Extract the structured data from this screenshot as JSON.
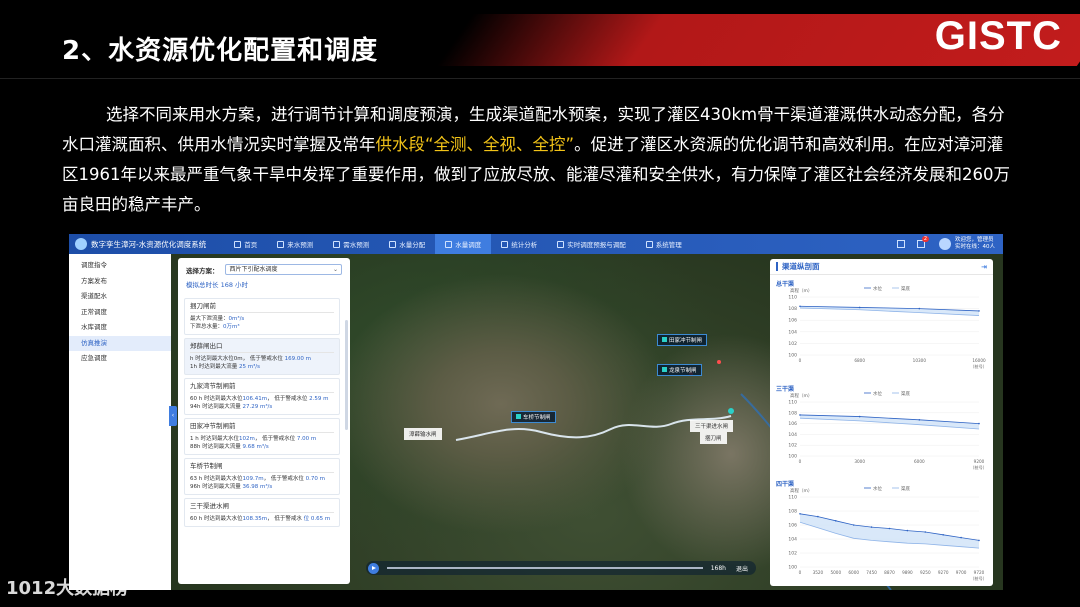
{
  "slide": {
    "title": "2、水资源优化配置和调度",
    "logo": "GISTC",
    "paragraph_pre": "选择不同来用水方案，进行调节计算和调度预演，生成渠道配水预案，实现了灌区430km骨干渠道灌溉供水动态分配，各分水口灌溉面积、供用水情况实时掌握及常年",
    "paragraph_hl": "供水段“全测、全视、全控”",
    "paragraph_post": "。促进了灌区水资源的优化调节和高效利用。在应对漳河灌区1961年以来最严重气象干旱中发挥了重要作用，做到了应放尽放、能灌尽灌和安全供水，有力保障了灌区社会经济发展和260万亩良田的稳产丰产。",
    "watermark": "1012大数据榜"
  },
  "colors": {
    "accent": "#2e63c4",
    "banner": "#c21c1c",
    "highlight": "#f2c318"
  },
  "app": {
    "title": "数字孪生漳河-水资源优化调度系统",
    "nav": [
      {
        "label": "首页",
        "icon": "home-icon"
      },
      {
        "label": "来水预测",
        "icon": "inflow-icon"
      },
      {
        "label": "需水预测",
        "icon": "demand-icon"
      },
      {
        "label": "水量分配",
        "icon": "allocation-icon"
      },
      {
        "label": "水量调度",
        "icon": "dispatch-icon",
        "active": true
      },
      {
        "label": "统计分析",
        "icon": "stats-icon"
      },
      {
        "label": "实时调度预报与调配",
        "icon": "realtime-icon"
      },
      {
        "label": "系统管理",
        "icon": "settings-icon"
      }
    ],
    "user": {
      "badge": "2",
      "name": "欢迎您，管理员",
      "online": "实时在线：40人"
    },
    "sidebar": [
      "调度指令",
      "方案发布",
      "渠道配水",
      "正常调度",
      "水库调度",
      "仿真推演",
      "应急调度"
    ],
    "sidebar_active": 5,
    "panel": {
      "select_label": "选择方案：",
      "select_value": "西片下引配水调度",
      "sim_time": "模拟总时长  168 小时",
      "cards": [
        {
          "title": "捆刀闸前",
          "lines": [
            [
              "最大下泄流量：",
              "0m³/s"
            ],
            [
              "下泄总水量：",
              "0万m³"
            ]
          ]
        },
        {
          "title": "郑薛闸出口",
          "active": true,
          "lines": [
            [
              "h  时达到最大水位0m，   低于警戒水位 ",
              "169.00 m"
            ],
            [
              "1h  时达到最大流量 ",
              "25 m³/s"
            ]
          ]
        },
        {
          "title": "九家湾节制闸前",
          "lines": [
            [
              "60 h   时达到最大水位",
              "106.41m",
              "，  低于警戒水位 ",
              "2.59 m"
            ],
            [
              "94h    时达到最大流量 ",
              "27.29 m³/s"
            ]
          ]
        },
        {
          "title": "田家冲节制闸前",
          "lines": [
            [
              "1 h    时达到最大水位",
              "102m",
              "，  低于警戒水位 ",
              "7.00 m"
            ],
            [
              "88h    时达到最大流量 ",
              "9.68 m³/s"
            ]
          ]
        },
        {
          "title": "车桥节制闸",
          "lines": [
            [
              "63 h   时达到最大水位",
              "109.7m",
              "，  低于警戒水位 ",
              "0.70 m"
            ],
            [
              "96h    时达到最大流量 ",
              "36.98 m³/s"
            ]
          ]
        },
        {
          "title": "三干渠进水闸",
          "lines": [
            [
              "60 h   时达到最大水位",
              "108.35m",
              "，  低于警戒水 ",
              "位 0.65 m"
            ]
          ]
        }
      ]
    },
    "map_labels": {
      "a": "田家冲节制闸",
      "b": "龙泉节制闸",
      "c": "车桥节制闸",
      "d": "漳薛输水闸",
      "e": "三干渠进水闸",
      "f": "捆刀闸"
    },
    "playback": {
      "time": "168h",
      "exit": "退出"
    },
    "profile": {
      "title": "渠道纵剖面",
      "legend_water": "水位",
      "legend_bed": "渠底",
      "y_unit": "高程（m）",
      "x_unit": "（桩号）"
    }
  },
  "chart_data": [
    {
      "type": "line",
      "title": "总干渠",
      "x": [
        0,
        6800,
        10300,
        16000
      ],
      "x_ticks": [
        "0",
        "6800",
        "10300",
        "16000"
      ],
      "ylim": [
        100,
        110
      ],
      "y_ticks": [
        110,
        108,
        106,
        104,
        102,
        100
      ],
      "series": [
        {
          "name": "水位",
          "values": [
            108.4,
            108.2,
            108.0,
            107.6
          ]
        },
        {
          "name": "渠底",
          "values": [
            108.1,
            107.8,
            107.3,
            106.8
          ]
        }
      ]
    },
    {
      "type": "line",
      "title": "三干渠",
      "x": [
        0,
        3000,
        6000,
        9200
      ],
      "x_ticks": [
        "0",
        "3000",
        "6000",
        "9200"
      ],
      "ylim": [
        100,
        110
      ],
      "y_ticks": [
        110,
        108,
        106,
        104,
        102,
        100
      ],
      "series": [
        {
          "name": "水位",
          "values": [
            107.6,
            107.3,
            106.7,
            106.0
          ]
        },
        {
          "name": "渠底",
          "values": [
            107.0,
            106.5,
            105.8,
            105.0
          ]
        }
      ]
    },
    {
      "type": "area",
      "title": "四干渠",
      "x": [
        0,
        3520,
        5000,
        6000,
        7450,
        8870,
        9890,
        9250,
        9270,
        9700,
        9720
      ],
      "x_ticks": [
        "0",
        "3520",
        "5000",
        "6000",
        "7450",
        "8870",
        "9890",
        "9250",
        "9270",
        "9700",
        "9720"
      ],
      "ylim": [
        100,
        110
      ],
      "y_ticks": [
        110,
        108,
        106,
        104,
        102,
        100
      ],
      "series": [
        {
          "name": "水位",
          "values": [
            107.6,
            107.2,
            106.6,
            106.0,
            105.7,
            105.5,
            105.2,
            105.0,
            104.6,
            104.2,
            103.8
          ]
        },
        {
          "name": "渠底",
          "values": [
            106.4,
            105.6,
            104.8,
            104.1,
            103.8,
            103.6,
            103.4,
            103.3,
            103.1,
            102.9,
            102.7
          ]
        }
      ]
    }
  ]
}
